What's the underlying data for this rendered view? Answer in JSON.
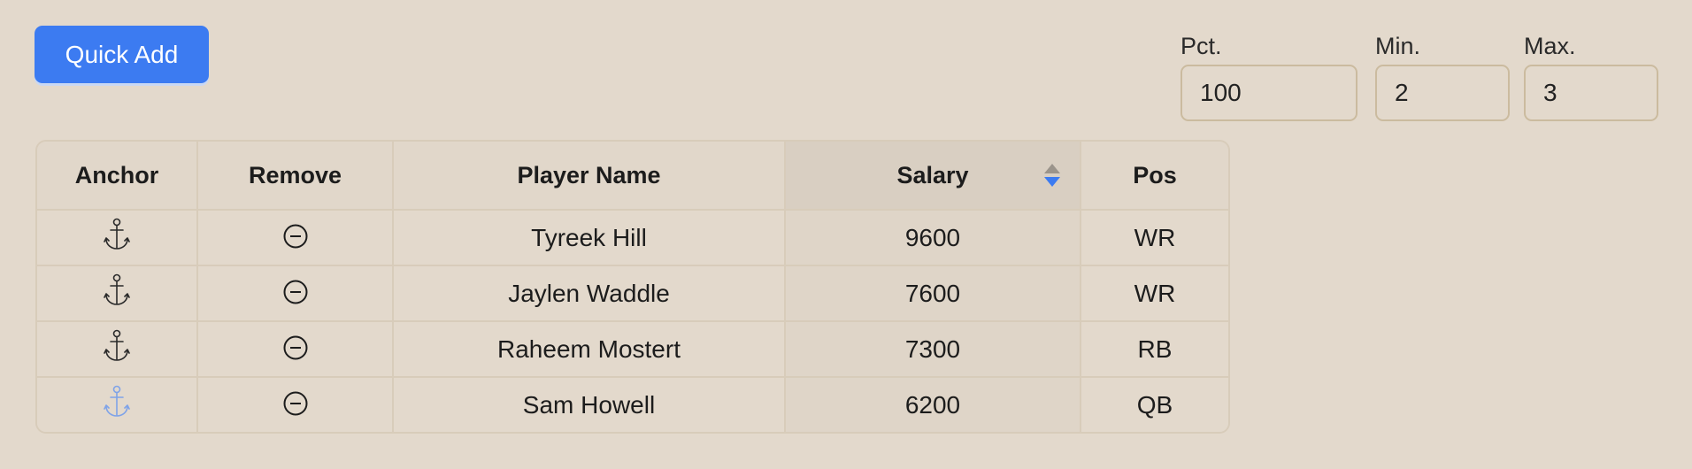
{
  "toolbar": {
    "quick_add_label": "Quick Add"
  },
  "settings": {
    "pct": {
      "label": "Pct.",
      "value": "100"
    },
    "min": {
      "label": "Min.",
      "value": "2"
    },
    "max": {
      "label": "Max.",
      "value": "3"
    }
  },
  "table": {
    "columns": {
      "anchor": "Anchor",
      "remove": "Remove",
      "player_name": "Player Name",
      "salary": "Salary",
      "pos": "Pos"
    },
    "sort": {
      "column": "salary",
      "direction": "descending"
    },
    "rows": [
      {
        "player_name": "Tyreek Hill",
        "salary": "9600",
        "pos": "WR",
        "anchor_active": false
      },
      {
        "player_name": "Jaylen Waddle",
        "salary": "7600",
        "pos": "WR",
        "anchor_active": false
      },
      {
        "player_name": "Raheem Mostert",
        "salary": "7300",
        "pos": "RB",
        "anchor_active": false
      },
      {
        "player_name": "Sam Howell",
        "salary": "6200",
        "pos": "QB",
        "anchor_active": true
      }
    ]
  },
  "icons": {
    "anchor": "anchor-icon",
    "remove": "minus-circle-icon",
    "sort": "sort-arrows-icon"
  },
  "colors": {
    "background": "#e3d9cc",
    "accent": "#3c7bf1",
    "anchor_default": "#2a2a2a",
    "anchor_active": "#7fa3e8",
    "border": "#d8ccba"
  }
}
